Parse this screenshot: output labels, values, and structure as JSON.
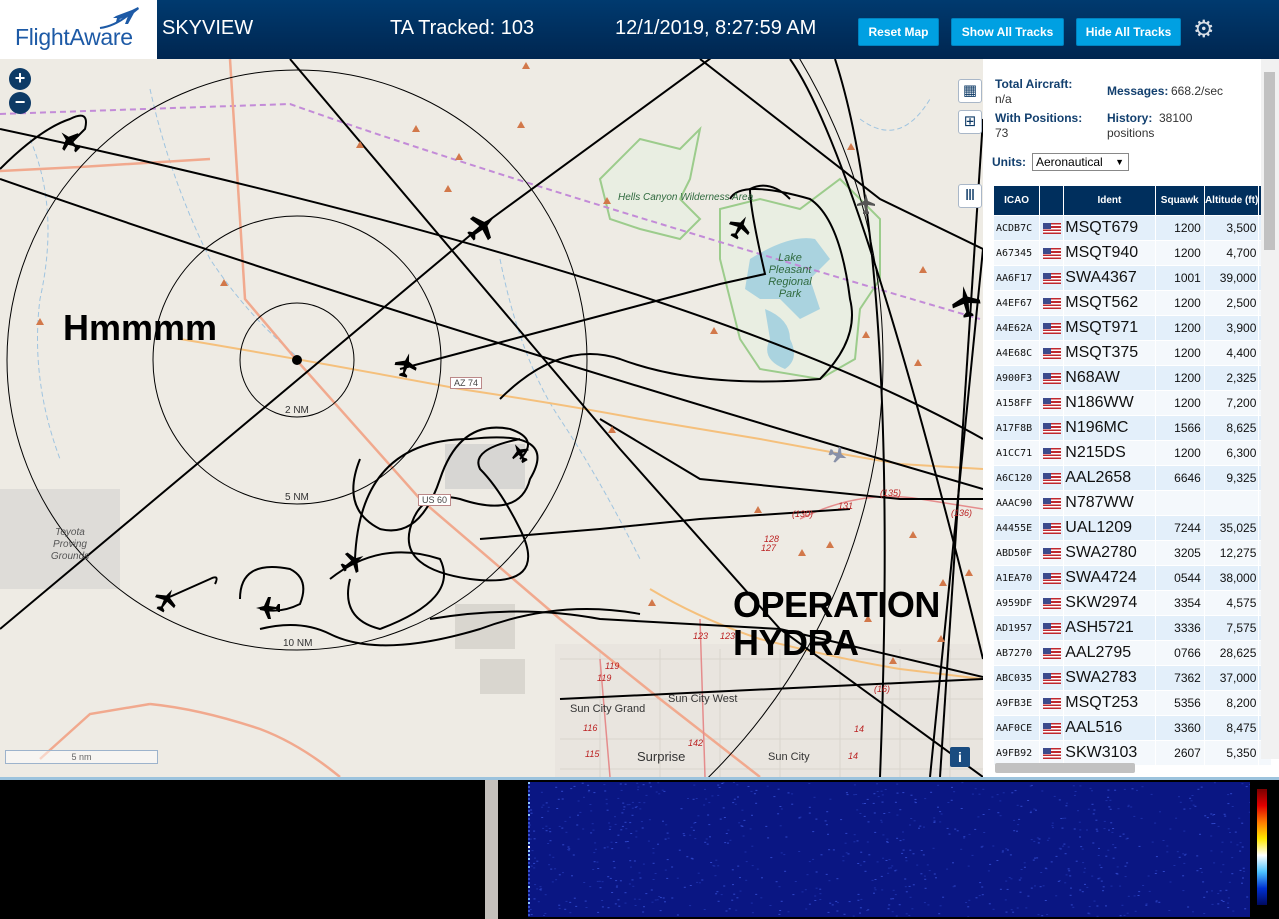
{
  "header": {
    "logo_text": "FlightAware",
    "app_title": "SKYVIEW",
    "tracked": "TA Tracked: 103",
    "clock": "12/1/2019, 8:27:59 AM",
    "buttons": {
      "reset": "Reset Map",
      "show_all": "Show All Tracks",
      "hide_all": "Hide All Tracks"
    },
    "settings_icon": "gear-icon",
    "brand_color": "#002f5d",
    "button_color": "#00a0e2"
  },
  "map": {
    "annotations": {
      "hmm": "Hmmmm",
      "operation": "OPERATION HYDRA"
    },
    "range_rings": [
      "2 NM",
      "5 NM",
      "10 NM"
    ],
    "scale": "5 nm",
    "places": {
      "hells_canyon": "Hells Canyon Wilderness Area",
      "lake_pleasant": "Lake Pleasant Regional Park",
      "toyota": "Toyota Proving Grounds",
      "sun_city_grand": "Sun City Grand",
      "sun_city_west": "Sun City West",
      "surprise": "Surprise",
      "sun_city": "Sun City"
    },
    "road_badges": {
      "az74": "AZ 74",
      "us60": "US 60"
    },
    "road_numbers": [
      "(135)",
      "131",
      "(130)",
      "(136)",
      "128",
      "127",
      "123",
      "123",
      "119",
      "119",
      "116",
      "115",
      "142",
      "14",
      "14",
      "(16)",
      "16"
    ],
    "controls": {
      "zoom_in": "+",
      "zoom_out": "−",
      "info": "i"
    }
  },
  "sidebar": {
    "total_aircraft_label": "Total Aircraft:",
    "total_aircraft_value": "n/a",
    "with_positions_label": "With Positions:",
    "with_positions_value": "73",
    "messages_label": "Messages:",
    "messages_value": "668.2/sec",
    "history_label": "History:",
    "history_value": "38100",
    "history_unit": "positions",
    "units_label": "Units:",
    "units_value": "Aeronautical",
    "columns": [
      "ICAO",
      "",
      "Ident",
      "Squawk",
      "Altitude (ft)"
    ],
    "rows": [
      {
        "icao": "ACDB7C",
        "ident": "MSQT679",
        "squawk": "1200",
        "alt": "3,500",
        "trend": "▼"
      },
      {
        "icao": "A67345",
        "ident": "MSQT940",
        "squawk": "1200",
        "alt": "4,700",
        "trend": ""
      },
      {
        "icao": "AA6F17",
        "ident": "SWA4367",
        "squawk": "1001",
        "alt": "39,000",
        "trend": ""
      },
      {
        "icao": "A4EF67",
        "ident": "MSQT562",
        "squawk": "1200",
        "alt": "2,500",
        "trend": ""
      },
      {
        "icao": "A4E62A",
        "ident": "MSQT971",
        "squawk": "1200",
        "alt": "3,900",
        "trend": "▲"
      },
      {
        "icao": "A4E68C",
        "ident": "MSQT375",
        "squawk": "1200",
        "alt": "4,400",
        "trend": "▼"
      },
      {
        "icao": "A900F3",
        "ident": "N68AW",
        "squawk": "1200",
        "alt": "2,325",
        "trend": "▼"
      },
      {
        "icao": "A158FF",
        "ident": "N186WW",
        "squawk": "1200",
        "alt": "7,200",
        "trend": "▲"
      },
      {
        "icao": "A17F8B",
        "ident": "N196MC",
        "squawk": "1566",
        "alt": "8,625",
        "trend": "▲"
      },
      {
        "icao": "A1CC71",
        "ident": "N215DS",
        "squawk": "1200",
        "alt": "6,300",
        "trend": ""
      },
      {
        "icao": "A6C120",
        "ident": "AAL2658",
        "squawk": "6646",
        "alt": "9,325",
        "trend": "▼"
      },
      {
        "icao": "AAAC90",
        "ident": "N787WW",
        "squawk": "",
        "alt": "",
        "trend": ""
      },
      {
        "icao": "A4455E",
        "ident": "UAL1209",
        "squawk": "7244",
        "alt": "35,025",
        "trend": ""
      },
      {
        "icao": "ABD50F",
        "ident": "SWA2780",
        "squawk": "3205",
        "alt": "12,275",
        "trend": "▼"
      },
      {
        "icao": "A1EA70",
        "ident": "SWA4724",
        "squawk": "0544",
        "alt": "38,000",
        "trend": ""
      },
      {
        "icao": "A959DF",
        "ident": "SKW2974",
        "squawk": "3354",
        "alt": "4,575",
        "trend": "▼"
      },
      {
        "icao": "AD1957",
        "ident": "ASH5721",
        "squawk": "3336",
        "alt": "7,575",
        "trend": "▼"
      },
      {
        "icao": "AB7270",
        "ident": "AAL2795",
        "squawk": "0766",
        "alt": "28,625",
        "trend": "▲"
      },
      {
        "icao": "ABC035",
        "ident": "SWA2783",
        "squawk": "7362",
        "alt": "37,000",
        "trend": ""
      },
      {
        "icao": "A9FB3E",
        "ident": "MSQT253",
        "squawk": "5356",
        "alt": "8,200",
        "trend": ""
      },
      {
        "icao": "AAF0CE",
        "ident": "AAL516",
        "squawk": "3360",
        "alt": "8,475",
        "trend": "▼"
      },
      {
        "icao": "A9FB92",
        "ident": "SKW3103",
        "squawk": "2607",
        "alt": "5,350",
        "trend": "▼"
      }
    ]
  }
}
